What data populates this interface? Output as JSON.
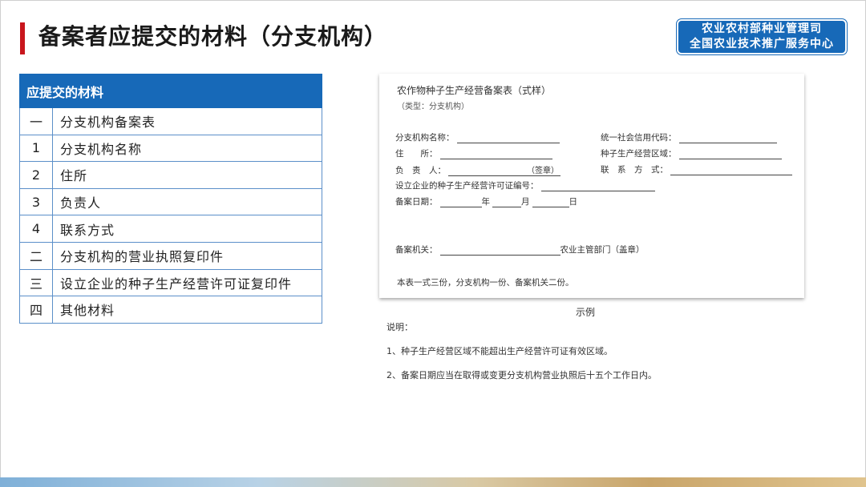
{
  "header": {
    "title": "备案者应提交的材料（分支机构）",
    "org_line1": "农业农村部种业管理司",
    "org_line2": "全国农业技术推广服务中心",
    "accent_color": "#c8161d",
    "brand_color": "#1769b8"
  },
  "materials": {
    "heading": "应提交的材料",
    "rows": [
      {
        "index": "一",
        "text": "分支机构备案表"
      },
      {
        "index": "1",
        "text": "分支机构名称"
      },
      {
        "index": "2",
        "text": "住所"
      },
      {
        "index": "3",
        "text": "负责人"
      },
      {
        "index": "4",
        "text": "联系方式"
      },
      {
        "index": "二",
        "text": "分支机构的营业执照复印件"
      },
      {
        "index": "三",
        "text": "设立企业的种子生产经营许可证复印件"
      },
      {
        "index": "四",
        "text": "其他材料"
      }
    ]
  },
  "form": {
    "title": "农作物种子生产经营备案表（式样）",
    "subtitle": "（类型：分支机构）",
    "branch_name": "分支机构名称：",
    "credit_code": "统一社会信用代码：",
    "address": "住　　所：",
    "region": "种子生产经营区域：",
    "manager": "负　责　人：",
    "signature": "（签章）",
    "contact": "联　系　方　式：",
    "license_no": "设立企业的种子生产经营许可证编号：",
    "date_label": "备案日期：",
    "year": "年",
    "month": "月",
    "day": "日",
    "authority": "备案机关：",
    "authority_suffix": "农业主管部门（盖章）",
    "copies_note": "本表一式三份，分支机构一份、备案机关二份。"
  },
  "caption": "示例",
  "notes": {
    "heading": "说明：",
    "items": [
      "1、种子生产经营区域不能超出生产经营许可证有效区域。",
      "2、备案日期应当在取得或变更分支机构营业执照后十五个工作日内。"
    ]
  }
}
